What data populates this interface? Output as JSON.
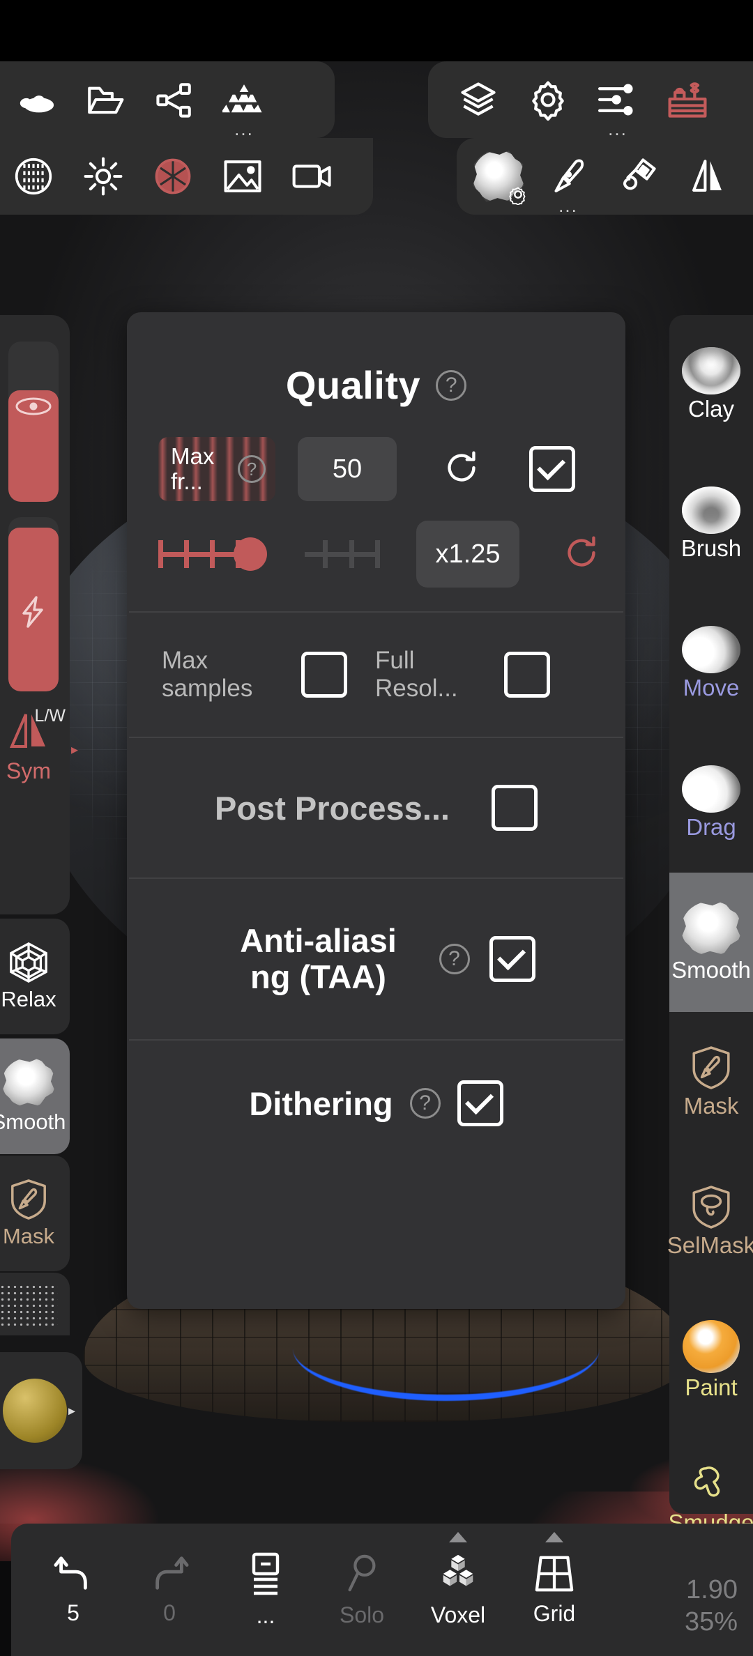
{
  "app": {
    "top_toolbar_row1_left": [
      {
        "name": "clay-ball-icon",
        "label": "Clay"
      },
      {
        "name": "folder-open-icon",
        "label": "Files"
      },
      {
        "name": "share-nodes-icon",
        "label": "Share"
      },
      {
        "name": "stack-blocks-icon",
        "label": "Scene",
        "more": "..."
      }
    ],
    "top_toolbar_row1_right": [
      {
        "name": "layers-icon",
        "label": "Layers"
      },
      {
        "name": "gear-icon",
        "label": "Settings"
      },
      {
        "name": "sliders-icon",
        "label": "Parameters",
        "more": "..."
      },
      {
        "name": "toolbox-icon",
        "label": "Toolbox",
        "color": "#c45b5b"
      }
    ],
    "top_toolbar_row2_left": [
      {
        "name": "matcap-sphere-icon",
        "label": "Matcap"
      },
      {
        "name": "sun-icon",
        "label": "Lighting"
      },
      {
        "name": "aperture-icon",
        "label": "Post Process",
        "color": "#c45b5b"
      },
      {
        "name": "image-icon",
        "label": "Background"
      },
      {
        "name": "video-camera-icon",
        "label": "Camera"
      }
    ],
    "top_toolbar_row2_right": [
      {
        "name": "smooth-brush-sphere-icon",
        "label": "Brush",
        "badge": "gear-badge-icon"
      },
      {
        "name": "paintbrush-icon",
        "label": "Stroke",
        "more": "..."
      },
      {
        "name": "paint-roller-icon",
        "label": "Paint"
      },
      {
        "name": "symmetry-mirror-icon",
        "label": "Symmetry"
      }
    ]
  },
  "left_panel": {
    "radius_slider": {
      "name": "brush-radius-slider",
      "icon": "radius-circle-icon",
      "fill_percent": 70
    },
    "intensity_slider": {
      "name": "brush-intensity-slider",
      "icon": "lightning-bolt-icon",
      "fill_percent": 94
    },
    "symmetry": {
      "mode_label": "L/W",
      "label": "Sym",
      "color": "#d16b6b"
    },
    "tools": [
      {
        "label": "Relax",
        "icon": "relax-web-icon",
        "selected": false,
        "color": "#ffffff"
      },
      {
        "label": "Smooth",
        "icon": "smooth-sphere-icon",
        "selected": true,
        "color": "#ffffff"
      },
      {
        "label": "Mask",
        "icon": "mask-shield-icon",
        "selected": false,
        "color": "#c7ab8c"
      }
    ],
    "material_chip": {
      "name": "material-swatch",
      "caret": "▸"
    }
  },
  "right_rail": {
    "items": [
      {
        "label": "Clay",
        "icon": "clay-sphere-icon",
        "color": "#ffffff",
        "selected": false
      },
      {
        "label": "Brush",
        "icon": "brush-sphere-icon",
        "color": "#ffffff",
        "selected": false
      },
      {
        "label": "Move",
        "icon": "move-sphere-icon",
        "color": "#9a9ae0",
        "selected": false
      },
      {
        "label": "Drag",
        "icon": "drag-sphere-icon",
        "color": "#9a9ae0",
        "selected": false
      },
      {
        "label": "Smooth",
        "icon": "smooth-sphere-icon",
        "color": "#ffffff",
        "selected": true
      },
      {
        "label": "Mask",
        "icon": "mask-shield-icon",
        "color": "#c7ab8c",
        "selected": false
      },
      {
        "label": "SelMask",
        "icon": "selmask-shield-icon",
        "color": "#c7ab8c",
        "selected": false
      },
      {
        "label": "Paint",
        "icon": "paint-sphere-icon",
        "color": "#e6e08a",
        "selected": false
      },
      {
        "label": "Smudge",
        "icon": "smudge-icon",
        "color": "#e6e08a",
        "selected": false
      }
    ]
  },
  "quality_dialog": {
    "title": "Quality",
    "title_help": "?",
    "max_frames": {
      "label": "Max fr...",
      "help": "?",
      "value": "50",
      "reset_icon": "reset-circular-arrow-icon",
      "enabled": true
    },
    "resolution_scale": {
      "value": "x1.25",
      "reset_icon": "reset-circular-arrow-icon",
      "ticks_filled": 4,
      "ticks_empty": 3,
      "thumb_percent": 52
    },
    "max_samples": {
      "label": "Max samples",
      "checked": false
    },
    "full_resolution": {
      "label": "Full Resol...",
      "checked": false
    },
    "post_process": {
      "label": "Post Process...",
      "checked": false
    },
    "anti_aliasing": {
      "label": "Anti-aliasing (TAA)",
      "label_line1": "Anti-aliasi",
      "label_line2": "ng (TAA)",
      "help": "?",
      "checked": true
    },
    "dithering": {
      "label": "Dithering",
      "help": "?",
      "checked": true
    }
  },
  "bottom_bar": {
    "items": [
      {
        "label": "5",
        "icon": "undo-arrow-icon",
        "dim": false,
        "caret": false
      },
      {
        "label": "0",
        "icon": "redo-arrow-icon",
        "dim": true,
        "caret": false
      },
      {
        "label": "...",
        "icon": "layers-list-icon",
        "dim": false,
        "caret": false
      },
      {
        "label": "Solo",
        "icon": "magnifier-icon",
        "dim": true,
        "caret": false
      },
      {
        "label": "Voxel",
        "icon": "voxel-cubes-icon",
        "dim": false,
        "caret": true
      },
      {
        "label": "Grid",
        "icon": "grid-icon",
        "dim": false,
        "caret": true
      }
    ],
    "zoom_readout": {
      "line1": "1.90",
      "line2": "35%"
    }
  },
  "colors": {
    "accent_red": "#c15a5a",
    "panel": "#2e2e2e",
    "dialog": "#323234",
    "selected": "#6f7073",
    "mask_tan": "#c7ab8c",
    "move_purple": "#9a9ae0",
    "paint_yellow": "#e6e08a"
  }
}
